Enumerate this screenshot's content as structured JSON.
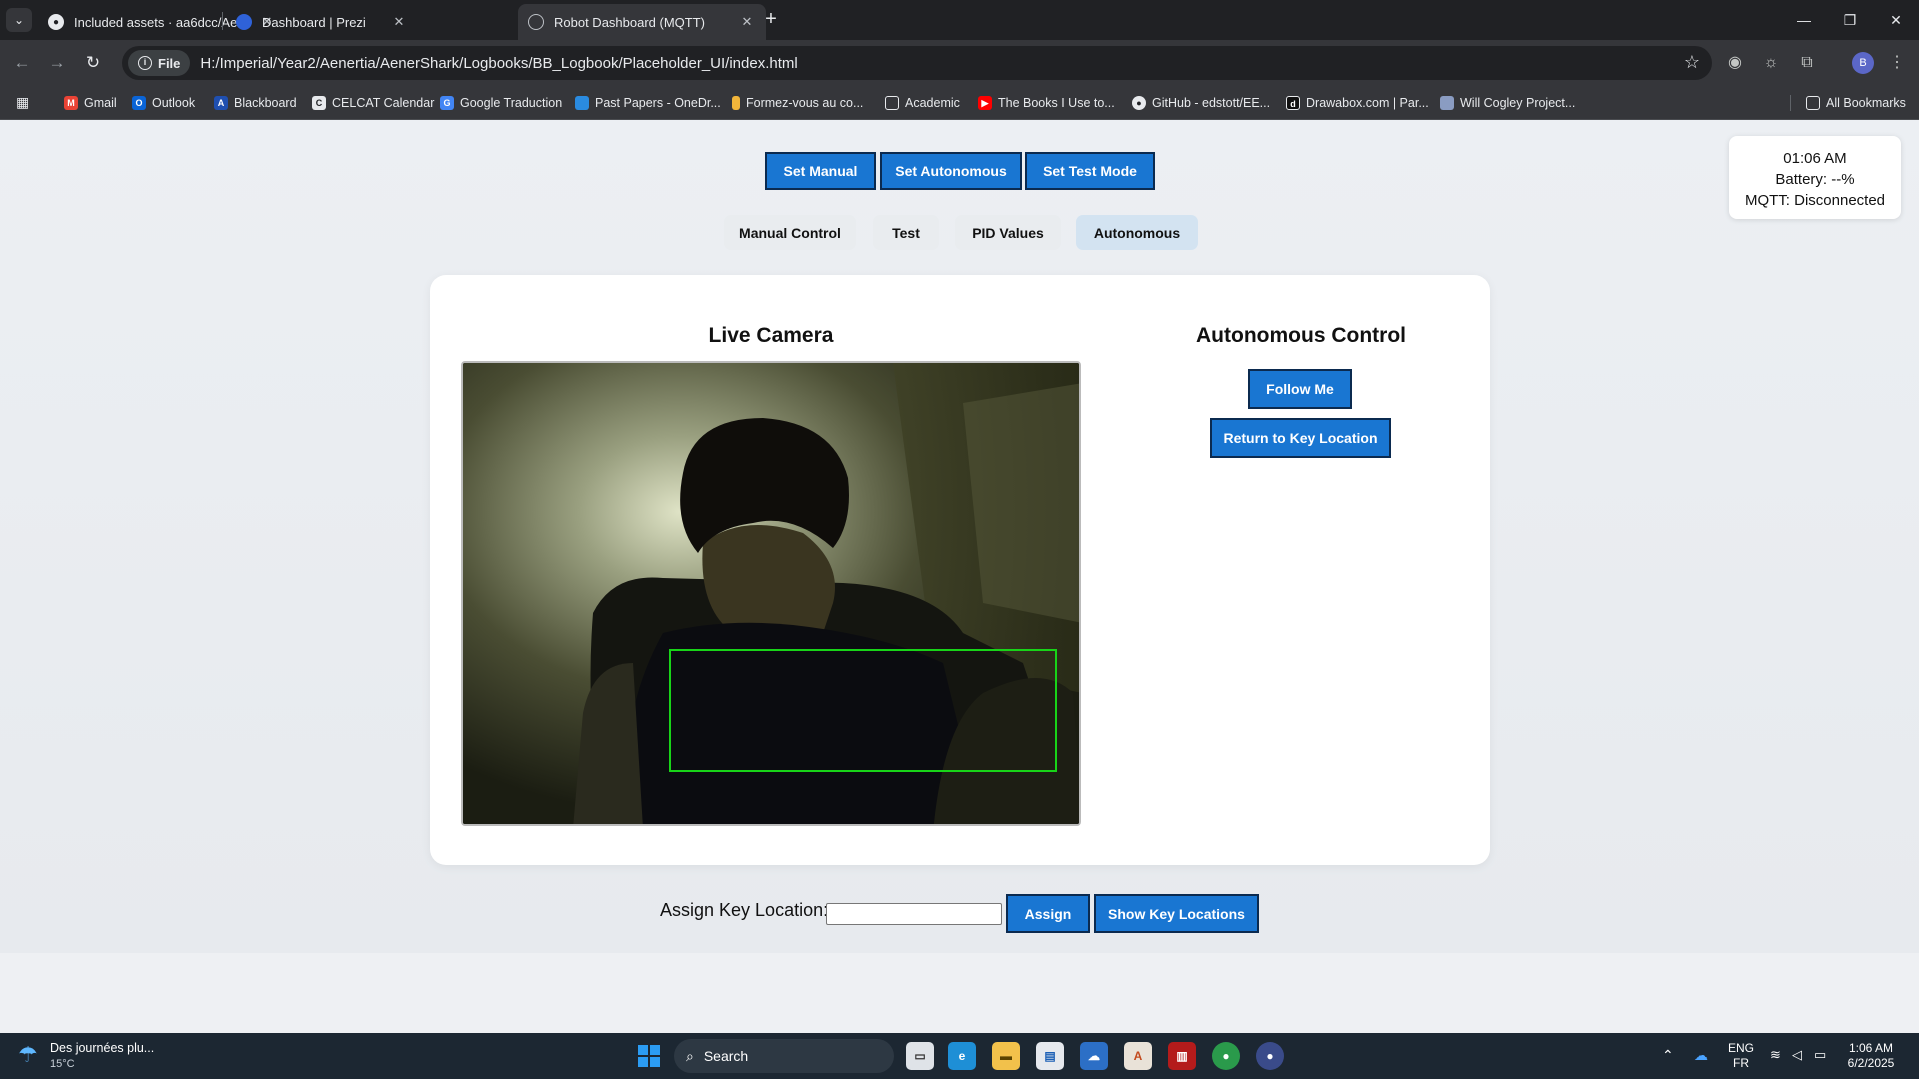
{
  "browser": {
    "tabs": [
      {
        "title": "Included assets · aa6dcc/Aene",
        "icon": "github-icon",
        "active": false
      },
      {
        "title": "Dashboard | Prezi",
        "icon": "prezi-icon",
        "active": false
      },
      {
        "title": "Robot Dashboard (MQTT)",
        "icon": "globe-icon",
        "active": true
      }
    ],
    "file_chip": "File",
    "url": "H:/Imperial/Year2/Aenertia/AenerShark/Logbooks/BB_Logbook/Placeholder_UI/index.html",
    "profile_initial": "B",
    "bookmarks": [
      {
        "label": "Gmail",
        "icon": "gmail-icon",
        "color": "#ea4335"
      },
      {
        "label": "Outlook",
        "icon": "outlook-icon",
        "color": "#0a64d6"
      },
      {
        "label": "Blackboard",
        "icon": "blackboard-icon",
        "color": "#1f4fb0"
      },
      {
        "label": "CELCAT Calendar",
        "icon": "celcat-icon",
        "color": "#e8eaed"
      },
      {
        "label": "Google Traduction",
        "icon": "translate-icon",
        "color": "#4285f4"
      },
      {
        "label": "Past Papers - OneDr...",
        "icon": "onedrive-icon",
        "color": "#2a8be0"
      },
      {
        "label": "Formez-vous au co...",
        "icon": "bulb-icon",
        "color": "#f2b53a"
      },
      {
        "label": "Academic",
        "icon": "folder-icon",
        "color": "#e8eaed"
      },
      {
        "label": "The Books I Use to...",
        "icon": "youtube-icon",
        "color": "#ff0000"
      },
      {
        "label": "GitHub - edstott/EE...",
        "icon": "github-icon",
        "color": "#e8eaed"
      },
      {
        "label": "Drawabox.com | Par...",
        "icon": "drawabox-icon",
        "color": "#111111"
      },
      {
        "label": "Will Cogley Project...",
        "icon": "cogley-icon",
        "color": "#8a9cc2"
      }
    ],
    "all_bookmarks": "All Bookmarks"
  },
  "page": {
    "mode_buttons": [
      "Set Manual",
      "Set Autonomous",
      "Set Test Mode"
    ],
    "tabs": [
      "Manual Control",
      "Test",
      "PID Values",
      "Autonomous"
    ],
    "active_tab": "Autonomous",
    "status": {
      "time": "01:06 AM",
      "battery": "Battery: --%",
      "mqtt": "MQTT: Disconnected"
    },
    "camera_title": "Live Camera",
    "autonomous_title": "Autonomous Control",
    "follow_me": "Follow Me",
    "return_key": "Return to Key Location",
    "assign_label": "Assign Key Location:",
    "assign_input_value": "",
    "assign_button": "Assign",
    "show_key_locations": "Show Key Locations",
    "accent_color": "#1976d2",
    "bbox_color": "#18d418"
  },
  "taskbar": {
    "weather_title": "Des journées plu...",
    "weather_temp": "15°C",
    "search": "Search",
    "lang_top": "ENG",
    "lang_bottom": "FR",
    "time": "1:06 AM",
    "date": "6/2/2025"
  }
}
